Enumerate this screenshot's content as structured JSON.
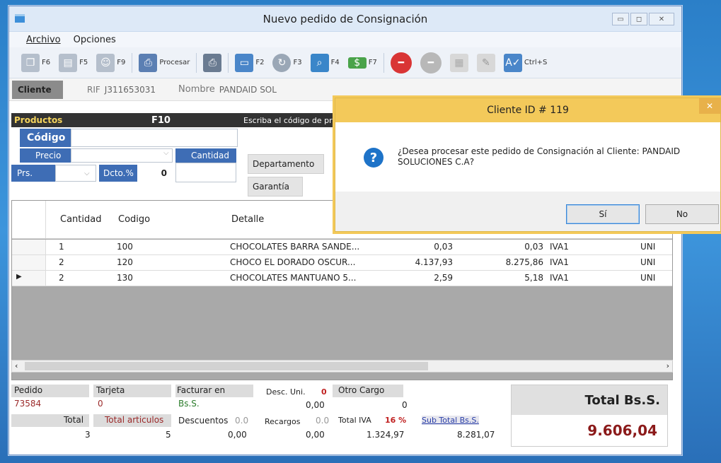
{
  "window": {
    "title": "Nuevo pedido de Consignación"
  },
  "menu": [
    "Archivo",
    "Opciones"
  ],
  "toolbar": {
    "f6": "F6",
    "f5": "F5",
    "f9": "F9",
    "procesar": "Procesar",
    "f2": "F2",
    "f3": "F3",
    "f4": "F4",
    "f7": "F7",
    "ctrls": "Ctrl+S"
  },
  "client": {
    "label": "Cliente",
    "rif_label": "RIF",
    "rif": "J311653031",
    "nombre_label": "Nombre",
    "nombre": "PANDAID SOL"
  },
  "products": {
    "header": "Productos",
    "f10": "F10",
    "hint": "Escriba el código de prod",
    "codigo": "Código",
    "precio": "Precio",
    "cantidad": "Cantidad",
    "departamento": "Departamento",
    "prs": "Prs.",
    "dcto": "Dcto.%",
    "dcto_val": "0",
    "garantia": "Garantía"
  },
  "grid": {
    "headers": [
      "Cantidad",
      "Codigo",
      "Detalle"
    ],
    "rows": [
      {
        "cantidad": "1",
        "codigo": "100",
        "detalle": "CHOCOLATES BARRA SANDE...",
        "precio": "0,03",
        "total": "0,03",
        "iva": "IVA1",
        "unidad": "UNI"
      },
      {
        "cantidad": "2",
        "codigo": "120",
        "detalle": "CHOCO EL DORADO OSCUR...",
        "precio": "4.137,93",
        "total": "8.275,86",
        "iva": "IVA1",
        "unidad": "UNI"
      },
      {
        "cantidad": "2",
        "codigo": "130",
        "detalle": "CHOCOLATES MANTUANO 5...",
        "precio": "2,59",
        "total": "5,18",
        "iva": "IVA1",
        "unidad": "UNI"
      }
    ]
  },
  "footer": {
    "pedido_label": "Pedido",
    "pedido": "73584",
    "tarjeta_label": "Tarjeta",
    "tarjeta": "0",
    "facturar_label": "Facturar en",
    "facturar": "Bs.S.",
    "desc_uni_label": "Desc. Uni.",
    "desc_uni_flag": "0",
    "desc_uni": "0,00",
    "otro_cargo_label": "Otro Cargo",
    "otro_cargo": "0",
    "total_label": "Total",
    "total": "3",
    "total_art_label": "Total articulos",
    "total_art": "5",
    "descuentos_label": "Descuentos",
    "descuentos_pct": "0.0",
    "descuentos": "0,00",
    "recargos_label": "Recargos",
    "recargos_pct": "0.0",
    "recargos": "0,00",
    "total_iva_label": "Total IVA",
    "total_iva_pct": "16 %",
    "total_iva": "1.324,97",
    "subtotal_label": "Sub Total Bs.S.",
    "subtotal": "8.281,07",
    "grand_label": "Total Bs.S.",
    "grand": "9.606,04"
  },
  "dialog": {
    "title": "Cliente ID # 119",
    "message": "¿Desea procesar este pedido de Consignación al Cliente: PANDAID SOLUCIONES C.A?",
    "yes": "Sí",
    "no": "No"
  }
}
